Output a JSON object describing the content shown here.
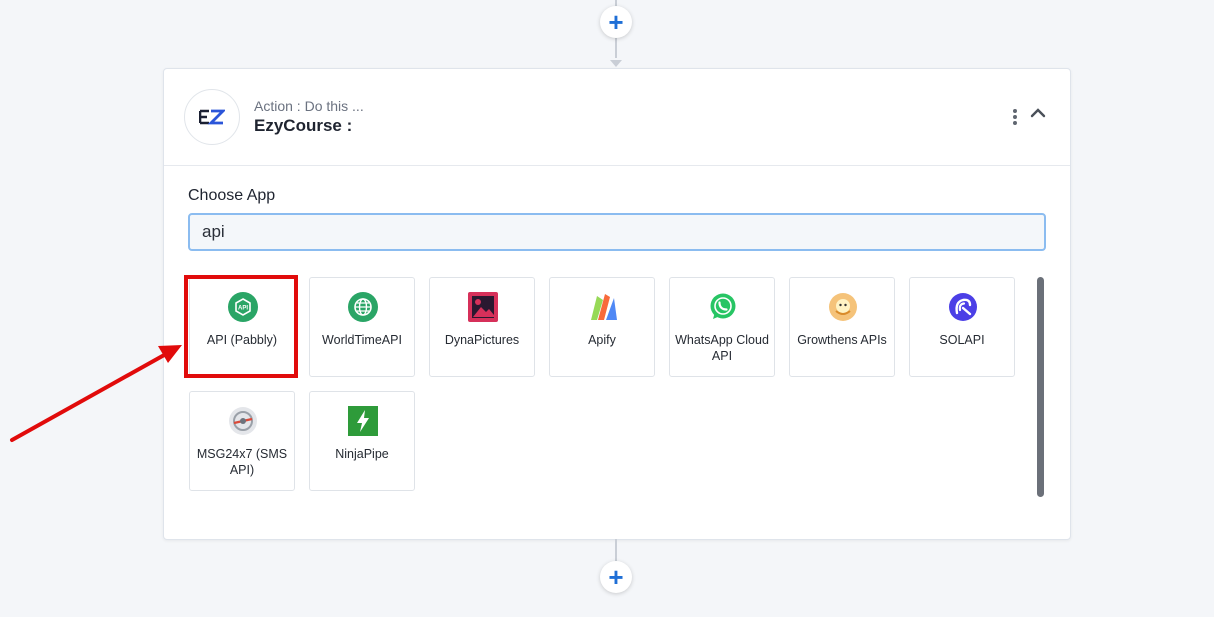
{
  "flow": {
    "add_step_top": "+",
    "add_step_bottom": "+"
  },
  "step": {
    "label": "Action : Do this ...",
    "title": "EzyCourse :",
    "logo_text": "EZ"
  },
  "chooser": {
    "label": "Choose App",
    "search_value": "api",
    "apps": [
      {
        "name": "API (Pabbly)",
        "icon": "api-pabbly-icon",
        "color": "#2aa566"
      },
      {
        "name": "WorldTimeAPI",
        "icon": "globe-icon",
        "color": "#2aa566"
      },
      {
        "name": "DynaPictures",
        "icon": "image-icon",
        "color": "#d6305a"
      },
      {
        "name": "Apify",
        "icon": "apify-logo-icon",
        "color": "#4f88f5"
      },
      {
        "name": "WhatsApp Cloud API",
        "icon": "whatsapp-icon",
        "color": "#27c564"
      },
      {
        "name": "Growthens APIs",
        "icon": "growthens-icon",
        "color": "#f4c15a"
      },
      {
        "name": "SOLAPI",
        "icon": "solapi-icon",
        "color": "#4b3fe6"
      },
      {
        "name": "MSG24x7 (SMS API)",
        "icon": "msg24x7-icon",
        "color": "#8a8f98"
      },
      {
        "name": "NinjaPipe",
        "icon": "lightning-icon",
        "color": "#2e9b3a"
      }
    ]
  },
  "colors": {
    "accent": "#1f6fd6",
    "highlight": "#e10b0b"
  }
}
